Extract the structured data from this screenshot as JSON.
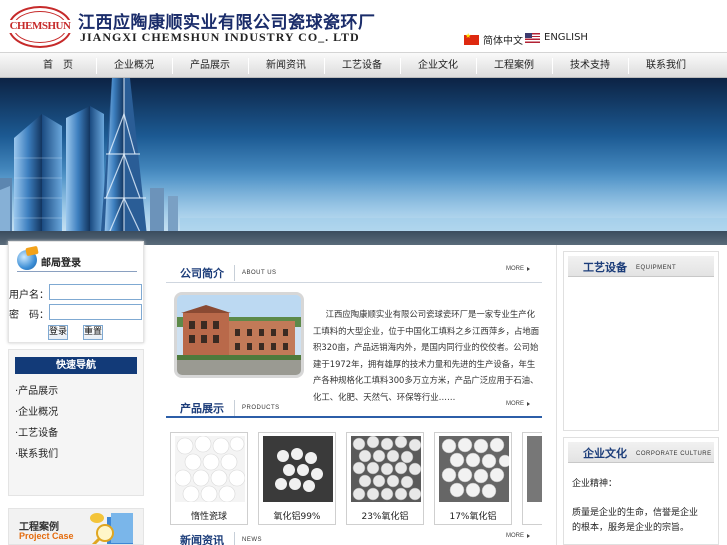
{
  "header": {
    "logo_text": "CHEMSHUN",
    "title_cn": "江西应陶康顺实业有限公司瓷球瓷环厂",
    "title_en": "JIANGXI CHEMSHUN INDUSTRY CO_. LTD",
    "lang_cn": "简体中文",
    "lang_en": "ENGLISH"
  },
  "nav": {
    "items": [
      "首　页",
      "企业概况",
      "产品展示",
      "新闻资讯",
      "工艺设备",
      "企业文化",
      "工程案例",
      "技术支持",
      "联系我们"
    ]
  },
  "login": {
    "title": "邮局登录",
    "user_label": "用户名：",
    "user_value": "",
    "pass_label": "密　码：",
    "pass_value": "",
    "login_btn": "登录",
    "reset_btn": "重置"
  },
  "quick": {
    "title": "快速导航",
    "items": [
      "·产品展示",
      "·企业概况",
      "·工艺设备",
      "·联系我们"
    ]
  },
  "cases": {
    "title_cn": "工程案例",
    "title_en": "Project Case"
  },
  "about": {
    "title": "公司简介",
    "sub": "ABOUT US",
    "more": "MORE",
    "text": "江西应陶康顺实业有限公司瓷球瓷环厂是一家专业生产化工填料的大型企业，位于中国化工填料之乡江西萍乡，占地面积320亩，产品远销海内外，是国内同行业的佼佼者。公司始建于1972年，拥有雄厚的技术力量和先进的生产设备，年生产各种规格化工填料300多万立方米，产品广泛应用于石油、化工、化肥、天然气、环保等行业……"
  },
  "products": {
    "title": "产品展示",
    "sub": "PRODUCTS",
    "more": "MORE",
    "items": [
      {
        "label": "惰性瓷球"
      },
      {
        "label": "氧化铝99%"
      },
      {
        "label": "23%氧化铝"
      },
      {
        "label": "17%氧化铝"
      }
    ]
  },
  "news": {
    "title": "新闻资讯",
    "sub": "NEWS",
    "more": "MORE"
  },
  "equipment": {
    "title": "工艺设备",
    "sub": "EQUIPMENT"
  },
  "culture": {
    "title": "企业文化",
    "sub": "CORPORATE CULTURE",
    "lines": [
      "企业精神：",
      "质量是企业的生命，信誉是企业",
      "的根本，服务是企业的宗旨。"
    ]
  },
  "colors": {
    "nav_blue": "#123a78",
    "title_blue": "#1c3d7a",
    "accent_red": "#c62a2a"
  }
}
